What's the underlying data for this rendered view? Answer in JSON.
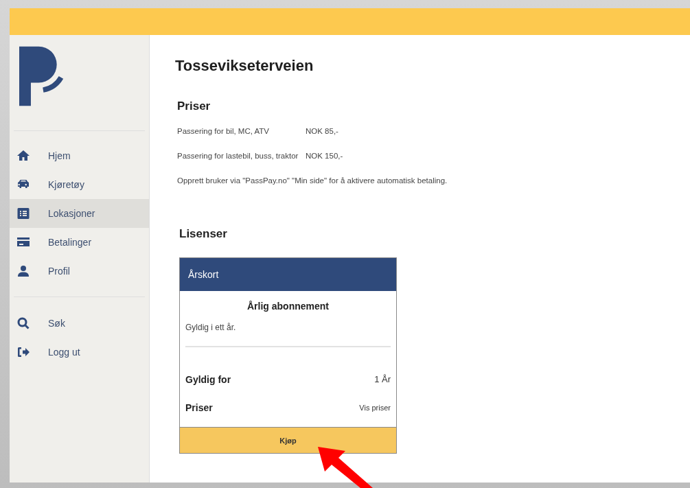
{
  "sidebar": {
    "items": [
      {
        "label": "Hjem",
        "kind": "home",
        "selected": false
      },
      {
        "label": "Kjøretøy",
        "kind": "vehicle",
        "selected": false
      },
      {
        "label": "Lokasjoner",
        "kind": "list",
        "selected": true
      },
      {
        "label": "Betalinger",
        "kind": "payment",
        "selected": false
      },
      {
        "label": "Profil",
        "kind": "profile",
        "selected": false
      }
    ],
    "secondary_items": [
      {
        "label": "Søk",
        "kind": "search",
        "selected": false
      },
      {
        "label": "Logg ut",
        "kind": "logout",
        "selected": false
      }
    ]
  },
  "page": {
    "title": "Tossevikseterveien",
    "prices": {
      "heading": "Priser",
      "rows": [
        {
          "label": "Passering for bil, MC, ATV",
          "value": "NOK 85,-"
        },
        {
          "label": "Passering for lastebil, buss, traktor",
          "value": "NOK 150,-"
        }
      ],
      "note": "Opprett bruker via \"PassPay.no\" \"Min side\" for å aktivere automatisk betaling."
    },
    "licenses": {
      "heading": "Lisenser",
      "cards": [
        {
          "header": "Årskort",
          "title": "Årlig abonnement",
          "description": "Gyldig i ett år.",
          "details": [
            {
              "label": "Gyldig for",
              "value": "1 År",
              "kind": "text"
            },
            {
              "label": "Priser",
              "value": "Vis priser",
              "kind": "link"
            }
          ],
          "button": "Kjøp"
        }
      ]
    }
  }
}
